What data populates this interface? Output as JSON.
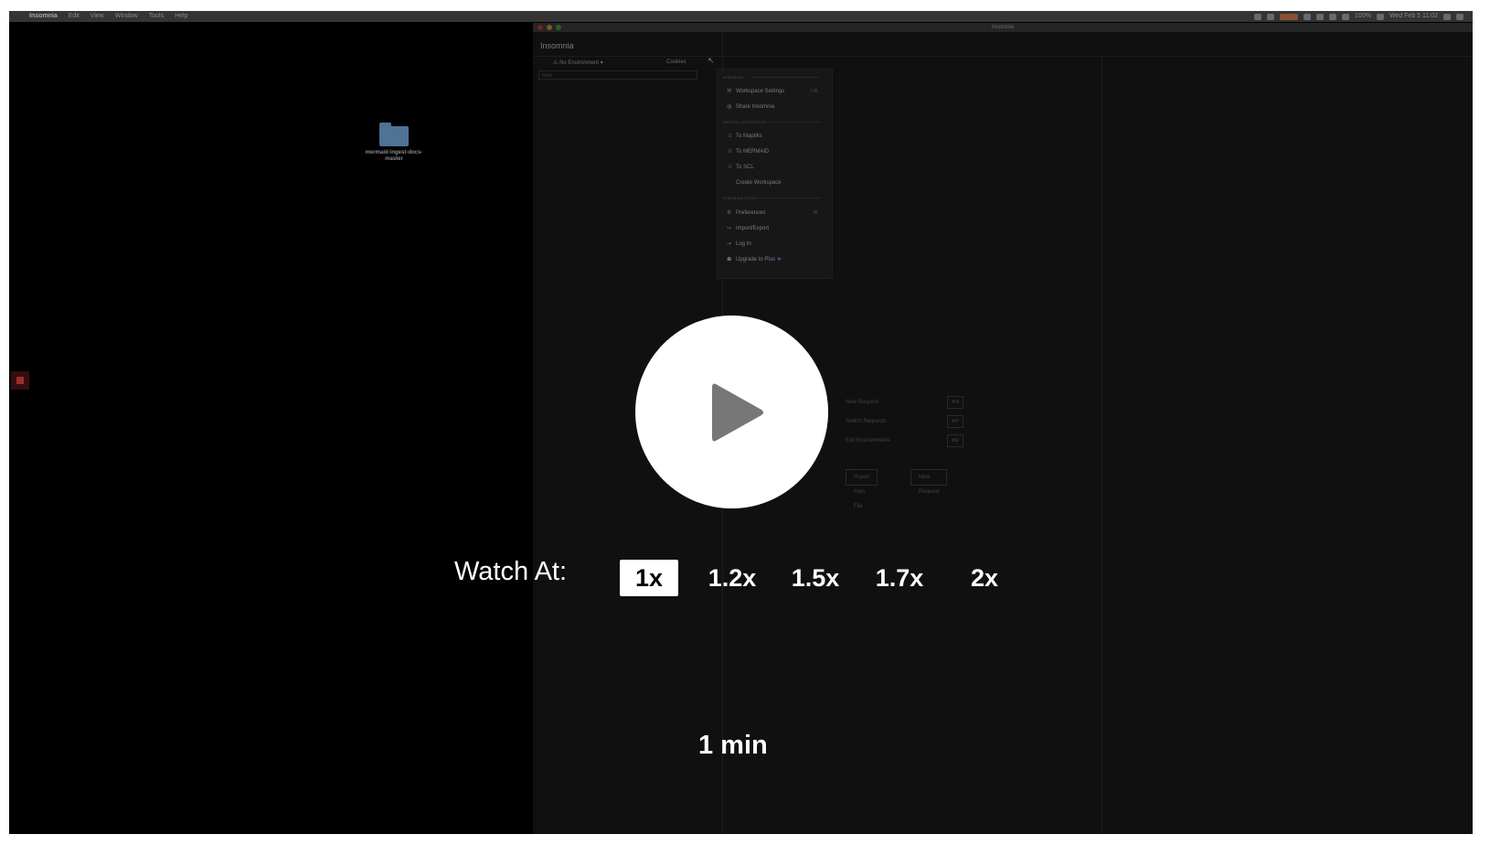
{
  "menubar": {
    "items": [
      "Insomnia",
      "Edit",
      "View",
      "Window",
      "Tools",
      "Help"
    ],
    "battery": "100%",
    "datetime": "Wed Feb 5  11:02"
  },
  "desktop": {
    "folder_label": "mermaid-ingest-docs-master"
  },
  "app": {
    "window_title": "Insomnia",
    "name": "Insomnia",
    "environment": "No Environment",
    "cookies": "Cookies",
    "filter_placeholder": "Filter"
  },
  "dropdown": {
    "sections": [
      "INSOMNIA",
      "SWITCH WORKSPACE",
      "INSOMNIA UTILS"
    ],
    "items": [
      {
        "label": "Workspace Settings",
        "icon": "wrench-icon",
        "shortcut": "⇧⌘,"
      },
      {
        "label": "Share Insomnia",
        "icon": "globe-icon"
      },
      {
        "label": "To Maptiks",
        "icon": "shuffle-icon"
      },
      {
        "label": "To MERMAID",
        "icon": "shuffle-icon"
      },
      {
        "label": "To SCL",
        "icon": "shuffle-icon"
      },
      {
        "label": "Create Workspace",
        "icon": ""
      },
      {
        "label": "Preferences",
        "icon": "gear-icon",
        "shortcut": "⌘,"
      },
      {
        "label": "Import/Export",
        "icon": "share-icon"
      },
      {
        "label": "Log In",
        "icon": "login-icon"
      },
      {
        "label": "Upgrade to Plus",
        "icon": "users-icon",
        "badge": "★"
      }
    ]
  },
  "empty_pane": {
    "rows": [
      {
        "label": "New Request",
        "shortcut": "⌘N"
      },
      {
        "label": "Switch Requests",
        "shortcut": "⌘P"
      },
      {
        "label": "Edit Environments",
        "shortcut": "⌘E"
      }
    ],
    "buttons": [
      "Import from File",
      "New Request"
    ]
  },
  "player": {
    "watch_label": "Watch At:",
    "speeds": [
      "1x",
      "1.2x",
      "1.5x",
      "1.7x",
      "2x"
    ],
    "selected_speed": "1x",
    "duration": "1 min"
  },
  "colors": {
    "overlay_text": "#ffffff",
    "play_button": "#ffffff",
    "play_icon": "#777777"
  }
}
